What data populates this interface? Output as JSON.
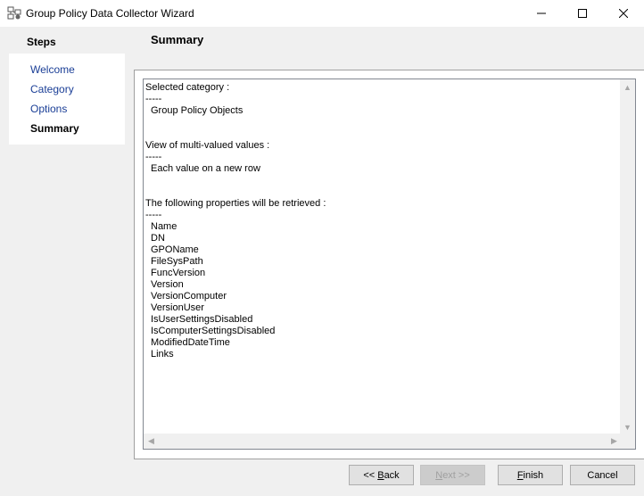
{
  "window": {
    "title": "Group Policy Data Collector Wizard"
  },
  "steps": {
    "header": "Steps",
    "items": [
      {
        "label": "Welcome",
        "active": false
      },
      {
        "label": "Category",
        "active": false
      },
      {
        "label": "Options",
        "active": false
      },
      {
        "label": "Summary",
        "active": true
      }
    ]
  },
  "page": {
    "title": "Summary"
  },
  "summary": {
    "lines": [
      {
        "text": "Selected category :",
        "indent": false
      },
      {
        "text": "-----",
        "indent": false
      },
      {
        "text": "Group Policy Objects",
        "indent": true
      },
      {
        "text": "",
        "indent": false
      },
      {
        "text": "",
        "indent": false
      },
      {
        "text": "View of multi-valued values :",
        "indent": false
      },
      {
        "text": "-----",
        "indent": false
      },
      {
        "text": "Each value on a new row",
        "indent": true
      },
      {
        "text": "",
        "indent": false
      },
      {
        "text": "",
        "indent": false
      },
      {
        "text": "The following properties will be retrieved :",
        "indent": false
      },
      {
        "text": "-----",
        "indent": false
      },
      {
        "text": "Name",
        "indent": true
      },
      {
        "text": "DN",
        "indent": true
      },
      {
        "text": "GPOName",
        "indent": true
      },
      {
        "text": "FileSysPath",
        "indent": true
      },
      {
        "text": "FuncVersion",
        "indent": true
      },
      {
        "text": "Version",
        "indent": true
      },
      {
        "text": "VersionComputer",
        "indent": true
      },
      {
        "text": "VersionUser",
        "indent": true
      },
      {
        "text": "IsUserSettingsDisabled",
        "indent": true
      },
      {
        "text": "IsComputerSettingsDisabled",
        "indent": true
      },
      {
        "text": "ModifiedDateTime",
        "indent": true
      },
      {
        "text": "Links",
        "indent": true
      }
    ]
  },
  "buttons": {
    "back_prefix": "<< ",
    "back_u": "B",
    "back_rest": "ack",
    "next_u": "N",
    "next_rest": "ext >>",
    "finish_u": "F",
    "finish_rest": "inish",
    "cancel": "Cancel"
  },
  "icons": {
    "app": "group-policy-icon",
    "minimize": "minimize-icon",
    "maximize": "maximize-icon",
    "close": "close-icon"
  }
}
